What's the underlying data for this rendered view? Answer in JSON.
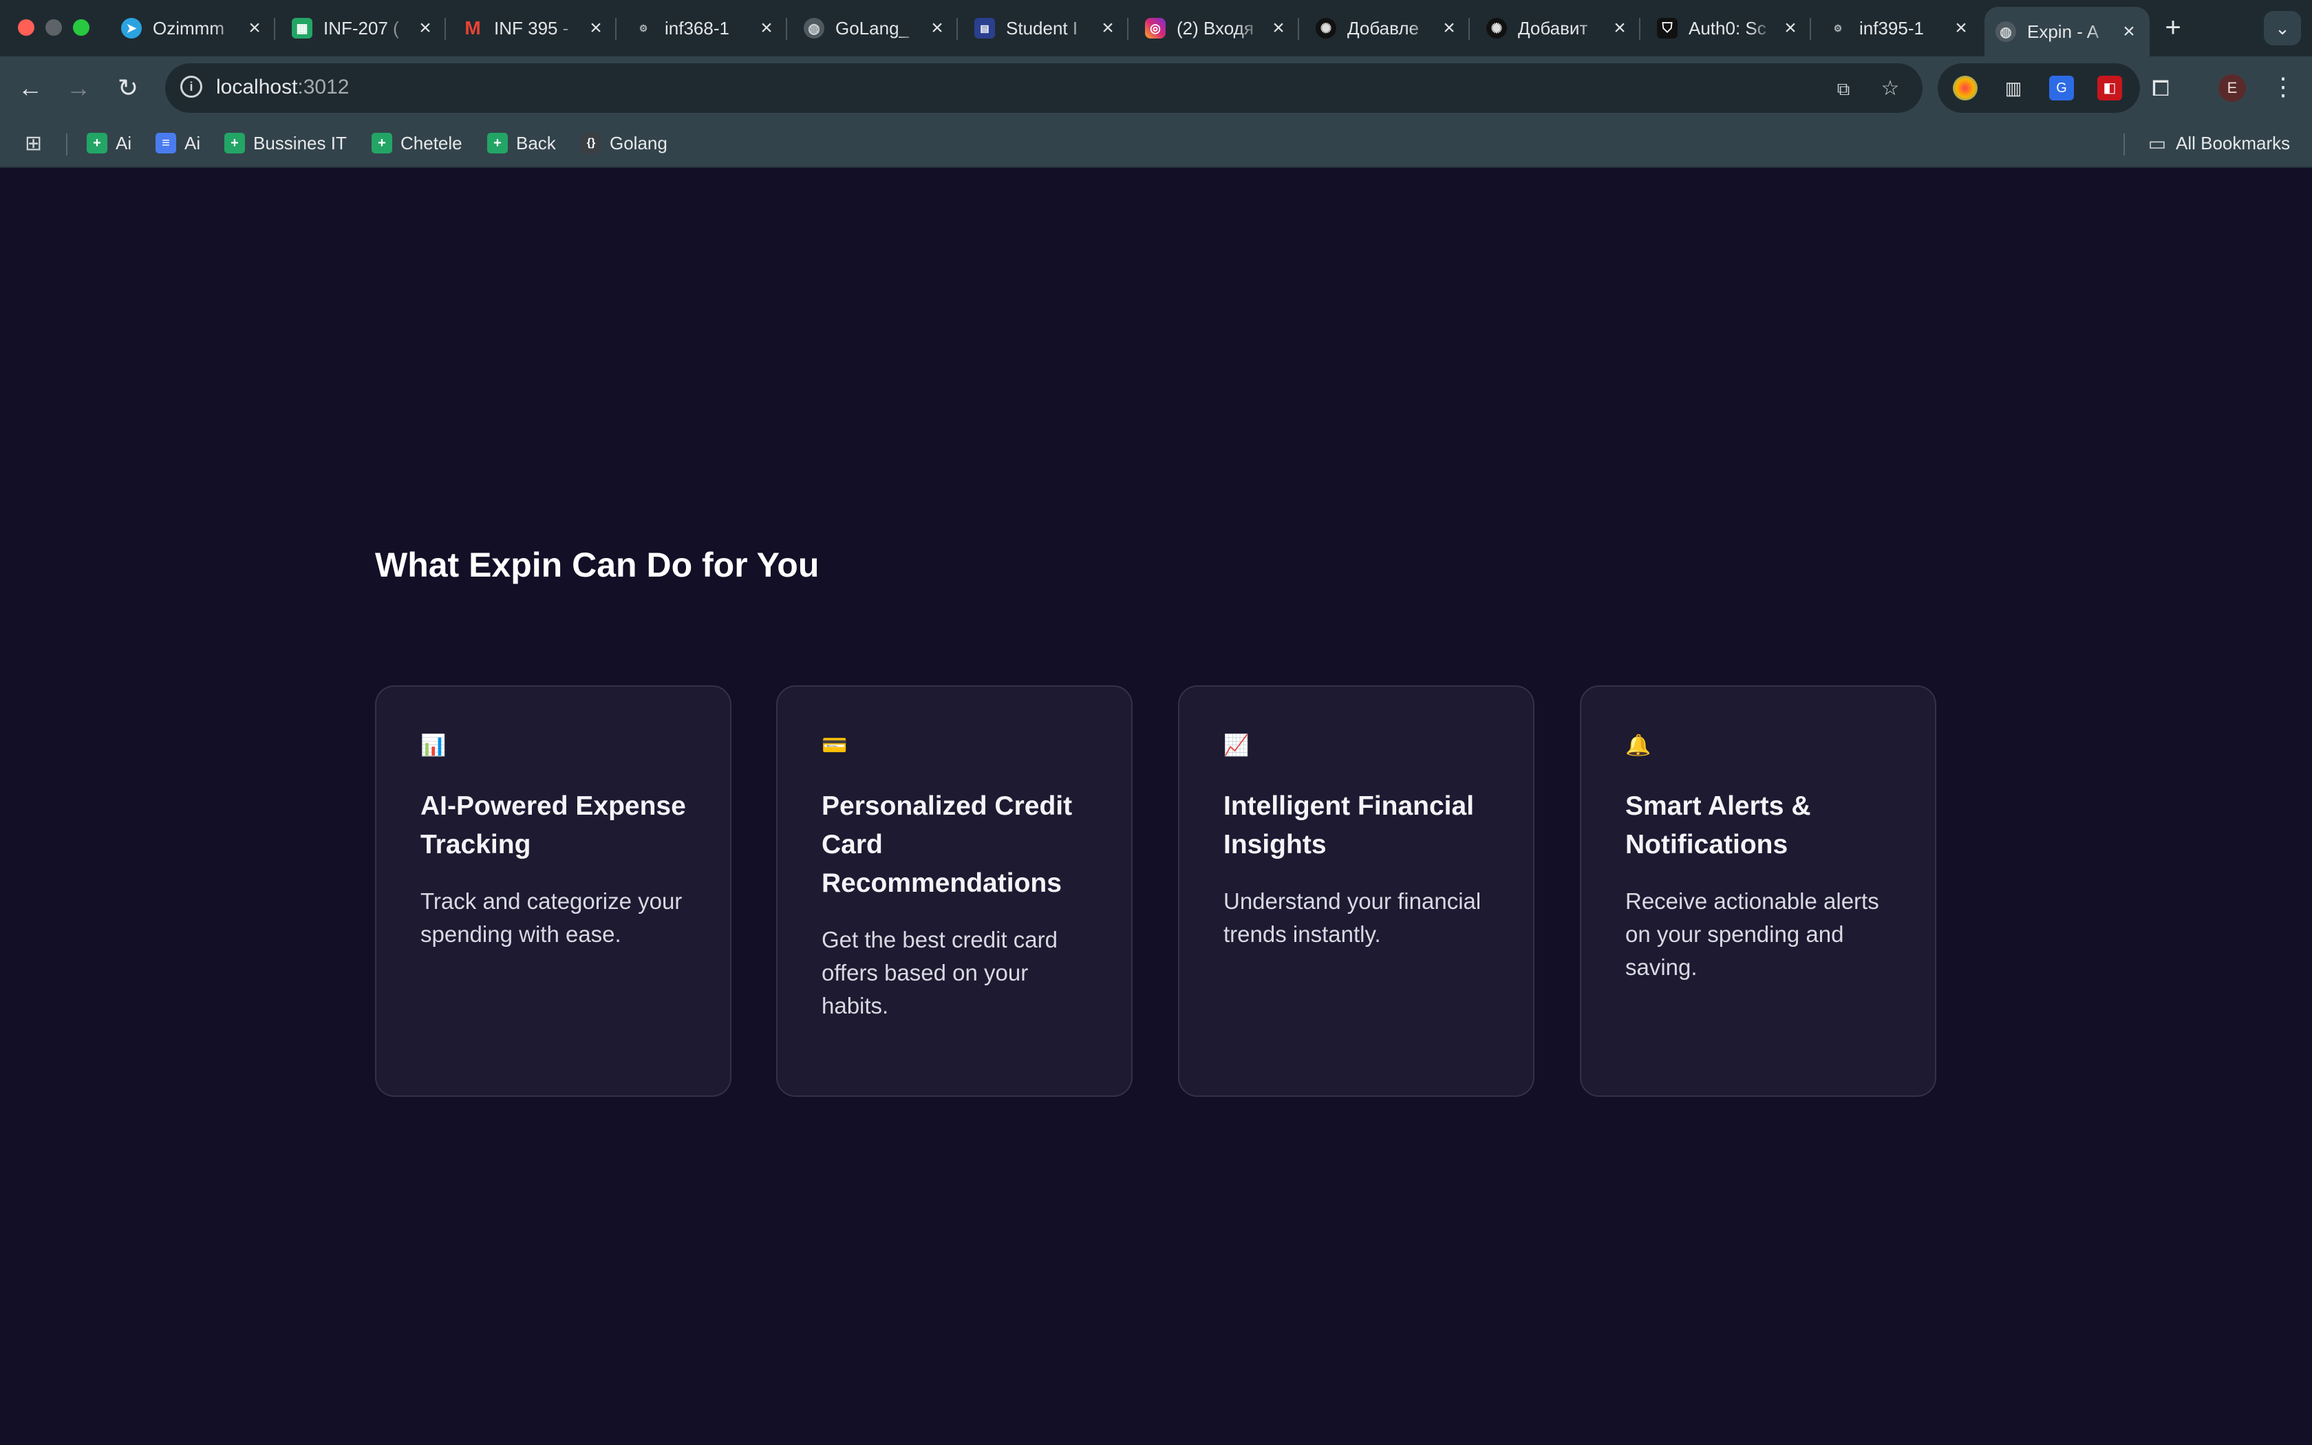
{
  "browser": {
    "tabs": [
      {
        "label": "Ozimmm",
        "icon": "telegram-icon",
        "color": "#2aa3e0"
      },
      {
        "label": "INF-207 (",
        "icon": "sheets-icon",
        "color": "#23a566"
      },
      {
        "label": "INF 395 -",
        "icon": "gmail-icon",
        "color": "#ea4335"
      },
      {
        "label": "inf368-1",
        "icon": "sdu-icon",
        "color": "#7a8a90"
      },
      {
        "label": "GoLang_",
        "icon": "globe-icon",
        "color": "#6b767c"
      },
      {
        "label": "Student I",
        "icon": "portal-icon",
        "color": "#2b3f8f"
      },
      {
        "label": "(2) Входя",
        "icon": "instagram-icon",
        "color": "#d62976"
      },
      {
        "label": "Добавле",
        "icon": "openai-icon",
        "color": "#111111"
      },
      {
        "label": "Добавит",
        "icon": "openai-icon",
        "color": "#111111"
      },
      {
        "label": "Auth0: Sc",
        "icon": "auth0-icon",
        "color": "#111111"
      },
      {
        "label": "inf395-1",
        "icon": "sdu-icon",
        "color": "#7a8a90"
      },
      {
        "label": "Expin - A",
        "icon": "globe-icon",
        "color": "#6b767c",
        "active": true
      }
    ],
    "tab_close": "×",
    "new_tab": "+",
    "tab_menu": "⌄",
    "url_host": "localhost",
    "url_port": ":3012",
    "avatar_letter": "E",
    "bookmarks": [
      {
        "label": "Ai",
        "icon": "sheets-icon",
        "color": "#23a566"
      },
      {
        "label": "Ai",
        "icon": "docs-icon",
        "color": "#4a7cf0"
      },
      {
        "label": "Bussines IT",
        "icon": "sheets-icon",
        "color": "#23a566"
      },
      {
        "label": "Chetele",
        "icon": "sheets-icon",
        "color": "#23a566"
      },
      {
        "label": "Back",
        "icon": "sheets-icon",
        "color": "#23a566"
      },
      {
        "label": "Golang",
        "icon": "braces-icon",
        "color": "#3a3f44"
      }
    ],
    "all_bookmarks": "All Bookmarks"
  },
  "page": {
    "section_title": "What Expin Can Do for You",
    "features": [
      {
        "icon": "📊",
        "icon_name": "bar-chart-icon",
        "title": "AI-Powered Expense Tracking",
        "description": "Track and categorize your spending with ease."
      },
      {
        "icon": "💳",
        "icon_name": "credit-card-icon",
        "title": "Personalized Credit Card Recommendations",
        "description": "Get the best credit card offers based on your habits."
      },
      {
        "icon": "📈",
        "icon_name": "trend-chart-icon",
        "title": "Intelligent Financial Insights",
        "description": "Understand your financial trends instantly."
      },
      {
        "icon": "🔔",
        "icon_name": "bell-icon",
        "title": "Smart Alerts & Notifications",
        "description": "Receive actionable alerts on your spending and saving."
      }
    ]
  },
  "colors": {
    "page_background": "#120f26",
    "card_background": "#1d1a31",
    "card_border": "#34314a",
    "chrome_dark": "#1f2a30",
    "chrome_toolbar": "#33434b"
  }
}
